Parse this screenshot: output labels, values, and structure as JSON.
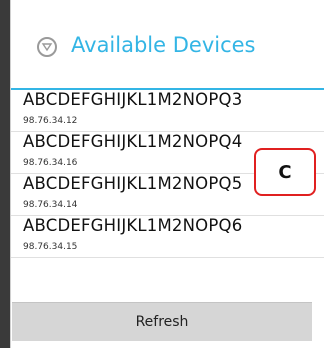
{
  "dialog": {
    "title": "Available Devices",
    "icon": "cast-icon",
    "accent_color": "#33b5e5"
  },
  "devices": [
    {
      "name": "ABCDEFGHIJKL1M2NOPQ3",
      "ip": "98.76.34.12"
    },
    {
      "name": "ABCDEFGHIJKL1M2NOPQ4",
      "ip": "98.76.34.16"
    },
    {
      "name": "ABCDEFGHIJKL1M2NOPQ5",
      "ip": "98.76.34.14"
    },
    {
      "name": "ABCDEFGHIJKL1M2NOPQ6",
      "ip": "98.76.34.15"
    }
  ],
  "refresh_label": "Refresh",
  "annotation": {
    "label": "C",
    "border_color": "#e02020"
  }
}
